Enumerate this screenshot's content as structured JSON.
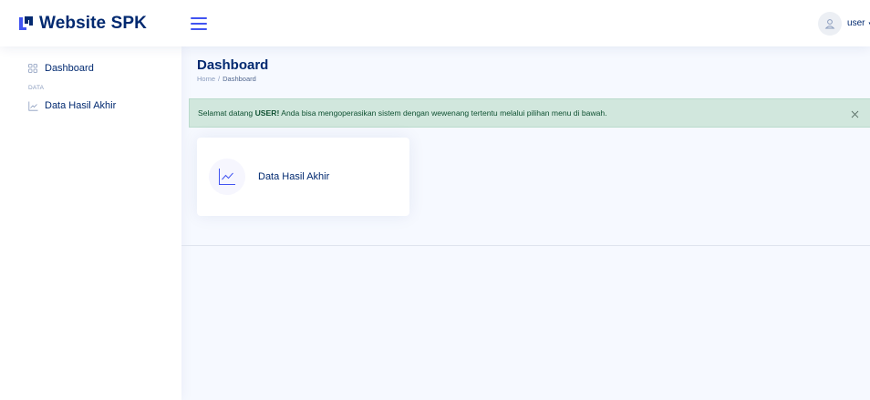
{
  "header": {
    "logo_text": "Website SPK",
    "user_label": "user",
    "caret": "▾"
  },
  "sidebar": {
    "items": [
      {
        "label": "Dashboard",
        "icon": "grid-icon"
      },
      {
        "label": "Data Hasil Akhir",
        "icon": "line-chart-icon"
      }
    ],
    "heading_data": "DATA"
  },
  "main": {
    "page_title": "Dashboard",
    "breadcrumb": {
      "home": "Home",
      "separator": "/",
      "current": "Dashboard"
    },
    "alert": {
      "prefix": "Selamat datang ",
      "strong": "USER!",
      "suffix": " Anda bisa mengoperasikan sistem dengan wewenang tertentu melalui pilihan menu di bawah.",
      "close_icon": "close-icon"
    },
    "card": {
      "label": "Data Hasil Akhir",
      "icon": "line-chart-icon"
    }
  },
  "colors": {
    "brand": "#012970",
    "accent": "#4154f1",
    "background": "#f6f9ff",
    "alert_bg": "#d1e7dd",
    "alert_text": "#0f5132"
  }
}
